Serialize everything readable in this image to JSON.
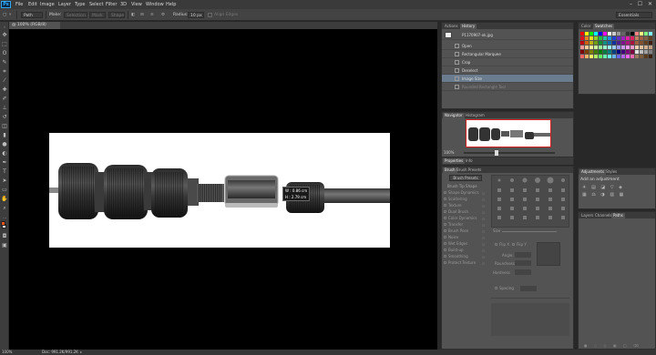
{
  "app": {
    "logo": "Ps"
  },
  "menu": [
    "File",
    "Edit",
    "Image",
    "Layer",
    "Type",
    "Select",
    "Filter",
    "3D",
    "View",
    "Window",
    "Help"
  ],
  "window_controls": {
    "min": "–",
    "max": "☐",
    "close": "✕"
  },
  "options": {
    "tool_mode": "Path",
    "make_label": "Make:",
    "selection_btn": "Selection...",
    "mask_btn": "Mask",
    "shape_btn": "Shape",
    "radius_label": "Radius:",
    "radius_value": "10 px",
    "align_edges": "Align Edges",
    "workspace": "Essentials"
  },
  "document": {
    "tab_label": "@ 100% (RGB/8)",
    "zoom": "100%",
    "doc_size": "Doc: 991.2K/991.2K"
  },
  "measurement": {
    "w": "W : 0.86 cm",
    "h": "H : 2.79 cm"
  },
  "history": {
    "tabs": [
      "Actions",
      "History"
    ],
    "snapshot": "P1170907-ok.jpg",
    "items": [
      {
        "label": "Open",
        "state": "normal"
      },
      {
        "label": "Rectangular Marquee",
        "state": "normal"
      },
      {
        "label": "Crop",
        "state": "normal"
      },
      {
        "label": "Deselect",
        "state": "normal"
      },
      {
        "label": "Image Size",
        "state": "active"
      },
      {
        "label": "Rounded Rectangle Tool",
        "state": "dimmed"
      }
    ]
  },
  "navigator": {
    "tabs": [
      "Navigator",
      "Histogram"
    ],
    "zoom": "100%"
  },
  "properties": {
    "tabs": [
      "Properties",
      "Info"
    ]
  },
  "brush": {
    "tabs": [
      "Brush",
      "Brush Presets"
    ],
    "presets_btn": "Brush Presets",
    "options": [
      "Brush Tip Shape",
      "Shape Dynamics",
      "Scattering",
      "Texture",
      "Dual Brush",
      "Color Dynamics",
      "Transfer",
      "Brush Pose",
      "Noise",
      "Wet Edges",
      "Build-up",
      "Smoothing",
      "Protect Texture"
    ],
    "size_label": "Size",
    "flip_x": "Flip X",
    "flip_y": "Flip Y",
    "angle_label": "Angle:",
    "roundness_label": "Roundness:",
    "hardness_label": "Hardness",
    "spacing_label": "Spacing"
  },
  "color_panel": {
    "tabs": [
      "Color",
      "Swatches"
    ]
  },
  "adjustments": {
    "tabs": [
      "Adjustments",
      "Styles"
    ],
    "add_label": "Add an adjustment"
  },
  "layers": {
    "tabs": [
      "Layers",
      "Channels",
      "Paths"
    ]
  },
  "colors": {
    "foreground": "#e8541b",
    "background": "#ffffff",
    "accent": "#31a8ff",
    "swatch_rows": [
      [
        "#ff0000",
        "#ffff00",
        "#00ff00",
        "#00ffff",
        "#0000ff",
        "#ff00ff",
        "#ffffff",
        "#cccccc",
        "#999999",
        "#666666",
        "#333333",
        "#000000",
        "#ff8080",
        "#ffff80",
        "#80ff80",
        "#80ffff"
      ],
      [
        "#e01020",
        "#f08020",
        "#f0e020",
        "#90d020",
        "#20c040",
        "#20c0a0",
        "#2090e0",
        "#2040d0",
        "#6030c0",
        "#a020c0",
        "#e020a0",
        "#e02060",
        "#c08060",
        "#a06040",
        "#806040",
        "#604020"
      ],
      [
        "#c00010",
        "#d06010",
        "#c0b010",
        "#70a010",
        "#109030",
        "#109080",
        "#1070b0",
        "#1030a0",
        "#502090",
        "#801090",
        "#b01080",
        "#b01040",
        "#a06040",
        "#805030",
        "#604020",
        "#402010"
      ],
      [
        "#ff9999",
        "#ffcc99",
        "#ffff99",
        "#ccff99",
        "#99ff99",
        "#99ffcc",
        "#99ffff",
        "#99ccff",
        "#9999ff",
        "#cc99ff",
        "#ff99ff",
        "#ff99cc",
        "#f0d0b0",
        "#e0c0a0",
        "#d0b090",
        "#c0a080"
      ],
      [
        "#800000",
        "#804000",
        "#808000",
        "#408000",
        "#008000",
        "#008040",
        "#008080",
        "#004080",
        "#000080",
        "#400080",
        "#800080",
        "#800040",
        "#e0e0e0",
        "#c0c0c0",
        "#a0a0a0",
        "#808080"
      ],
      [
        "#ff6666",
        "#ffb266",
        "#ffff66",
        "#b2ff66",
        "#66ff66",
        "#66ffb2",
        "#66ffff",
        "#66b2ff",
        "#6666ff",
        "#b266ff",
        "#ff66ff",
        "#ff66b2",
        "#9a7a5a",
        "#7a5a3a",
        "#5a3a1a",
        "#3a2010"
      ]
    ]
  }
}
